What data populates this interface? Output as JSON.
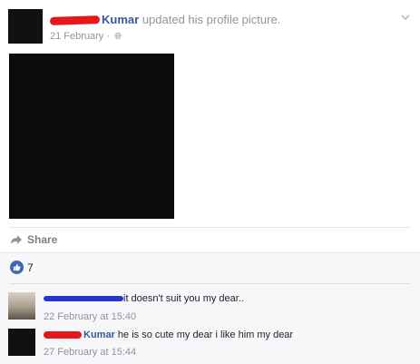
{
  "post": {
    "author_name": "Kumar",
    "action_text": "updated his profile picture.",
    "date": "21 February",
    "privacy_icon": "globe-icon"
  },
  "actions": {
    "share_label": "Share"
  },
  "reactions": {
    "like_count": "7"
  },
  "comments": [
    {
      "text": "it doesn't suit you my dear..",
      "time": "22 February at 15:40"
    },
    {
      "author_name": "Kumar",
      "text": "he is so cute my dear i like him my dear",
      "time": "27 February at 15:44"
    }
  ],
  "colors": {
    "link": "#365899",
    "meta": "#90949c",
    "like_blue": "#4267b2",
    "redaction_red": "#e5171d",
    "redaction_blue": "#2a34c8"
  }
}
